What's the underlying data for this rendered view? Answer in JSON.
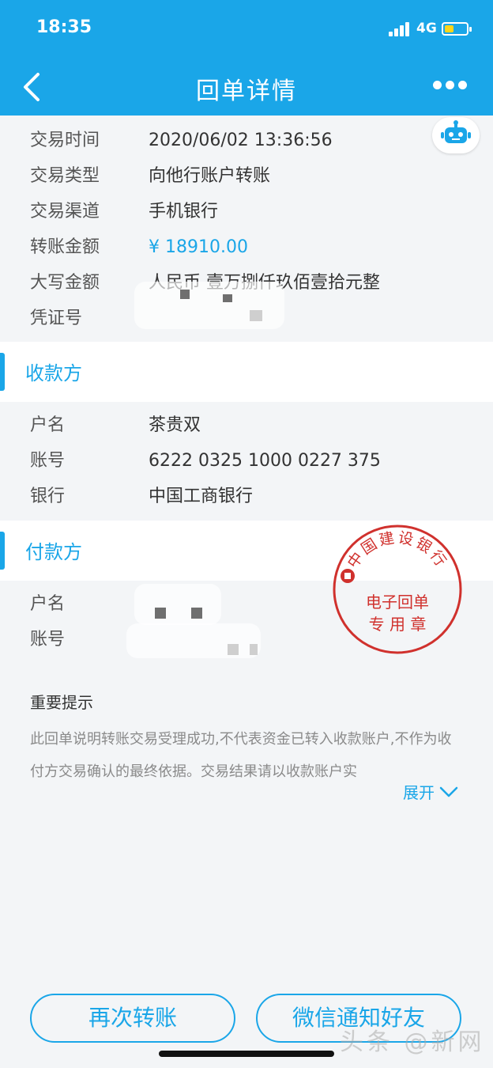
{
  "status_bar": {
    "time": "18:35",
    "network": "4G"
  },
  "nav": {
    "title": "回单详情"
  },
  "transaction": [
    {
      "label": "交易时间",
      "value": "2020/06/02 13:36:56"
    },
    {
      "label": "交易类型",
      "value": "向他行账户转账"
    },
    {
      "label": "交易渠道",
      "value": "手机银行"
    },
    {
      "label": "转账金额",
      "value": "¥ 18910.00"
    },
    {
      "label": "大写金额",
      "value": "人民币 壹万捌仟玖佰壹拾元整"
    },
    {
      "label": "凭证号",
      "value": ""
    }
  ],
  "payee": {
    "title": "收款方",
    "rows": [
      {
        "label": "户名",
        "value": "茶贵双"
      },
      {
        "label": "账号",
        "value": "6222 0325 1000 0227 375"
      },
      {
        "label": "银行",
        "value": "中国工商银行"
      }
    ]
  },
  "payer": {
    "title": "付款方",
    "rows": [
      {
        "label": "户名",
        "value": ""
      },
      {
        "label": "账号",
        "value": ""
      }
    ]
  },
  "stamp": {
    "bank": "中国建设银行",
    "line1": "电子回单",
    "line2": "专 用 章"
  },
  "notice": {
    "title": "重要提示",
    "text": "此回单说明转账交易受理成功,不代表资金已转入收款账户,不作为收付方交易确认的最终依据。交易结果请以收款账户实",
    "expand_label": "展开"
  },
  "buttons": {
    "again": "再次转账",
    "wechat": "微信通知好友"
  },
  "watermark": "头条 @新网",
  "colors": {
    "accent": "#1aa6e8",
    "stamp": "#d0312d",
    "background": "#f3f5f7"
  }
}
